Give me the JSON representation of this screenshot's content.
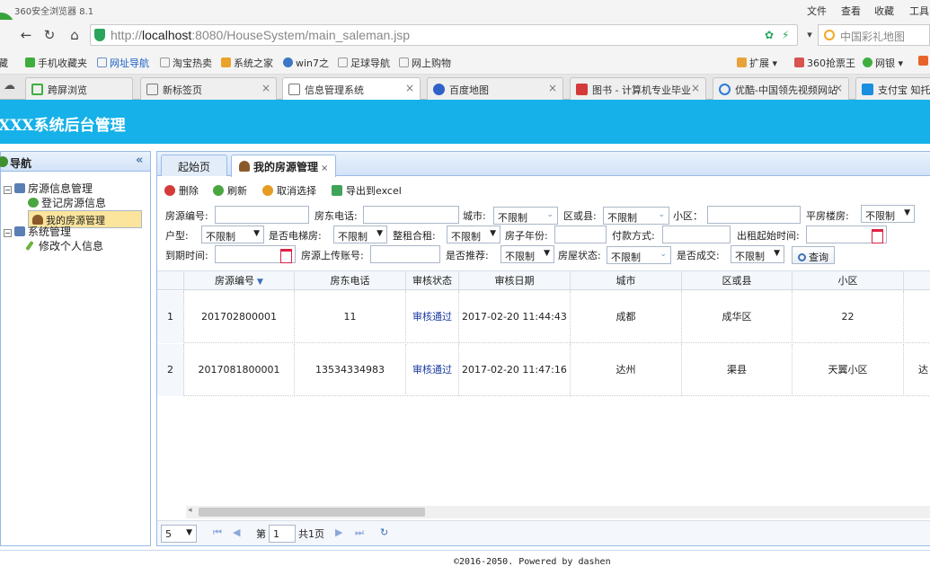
{
  "browser": {
    "title": "360安全浏览器 8.1",
    "menu": [
      "文件",
      "查看",
      "收藏",
      "工具"
    ],
    "url_host": "http://",
    "url_main": "localhost",
    "url_rest": ":8080/HouseSystem/main_saleman.jsp",
    "search_placeholder": "中国彩礼地图",
    "bookmarks": [
      "藏",
      "手机收藏夹",
      "网址导航",
      "淘宝热卖",
      "系统之家",
      "win7之",
      "足球导航",
      "网上购物"
    ],
    "bookmarks_right": [
      "扩展",
      "360抢票王",
      "网银"
    ],
    "tabs": [
      "跨屏浏览",
      "新标签页",
      "信息管理系统",
      "百度地图",
      "图书 - 计算机专业毕业",
      "优酷-中国领先视频网站",
      "支付宝 知托"
    ],
    "colors": {
      "app_header": "#16b1e8",
      "panel_border": "#99bbe8",
      "link": "#1a3aa0"
    }
  },
  "app": {
    "title": "XXX系统后台管理",
    "nav": {
      "title": "导航",
      "collapse": "«",
      "items": [
        {
          "label": "房源信息管理",
          "level": 0
        },
        {
          "label": "登记房源信息",
          "level": 1
        },
        {
          "label": "我的房源管理",
          "level": 1,
          "selected": true
        },
        {
          "label": "系统管理",
          "level": 0
        },
        {
          "label": "修改个人信息",
          "level": 1
        }
      ]
    },
    "tabs": [
      {
        "label": "起始页"
      },
      {
        "label": "我的房源管理",
        "active": true,
        "close": "×"
      }
    ],
    "toolbar": {
      "delete": "删除",
      "refresh": "刷新",
      "unselect": "取消选择",
      "export": "导出到excel"
    },
    "filters": {
      "house_no": "房源编号:",
      "owner_phone": "房东电话:",
      "city": "城市:",
      "district": "区或县:",
      "community": "小区：",
      "flat_floor": "平房楼房:",
      "house_type": "户型:",
      "elevator": "是否电梯房:",
      "rent_mode": "整租合租:",
      "build_year": "房子年份:",
      "pay_mode": "付款方式:",
      "rent_start": "出租起始时间:",
      "expire": "到期时间:",
      "uploader": "房源上传账号:",
      "recommend": "是否推荐:",
      "status": "房屋状态:",
      "deal": "是否成交:",
      "unlimited": "不限制",
      "query": "查询"
    },
    "grid": {
      "columns": [
        "房源编号",
        "房东电话",
        "审核状态",
        "审核日期",
        "城市",
        "区或县",
        "小区"
      ],
      "sort_indicator": "▼",
      "rows": [
        {
          "rownum": "1",
          "house_no": "201702800001",
          "phone": "11",
          "audit": "审核通过",
          "date": "2017-02-20 11:44:43",
          "city": "成都",
          "district": "成华区",
          "community": "22",
          "extra": ""
        },
        {
          "rownum": "2",
          "house_no": "2017081800001",
          "phone": "13534334983",
          "audit": "审核通过",
          "date": "2017-02-20 11:47:16",
          "city": "达州",
          "district": "渠县",
          "community": "天翼小区",
          "extra": "达"
        }
      ]
    },
    "pager": {
      "page_size": "5",
      "page_prefix": "第",
      "page": "1",
      "page_total": "共1页"
    },
    "footer": "©2016-2050. Powered by dashen"
  }
}
